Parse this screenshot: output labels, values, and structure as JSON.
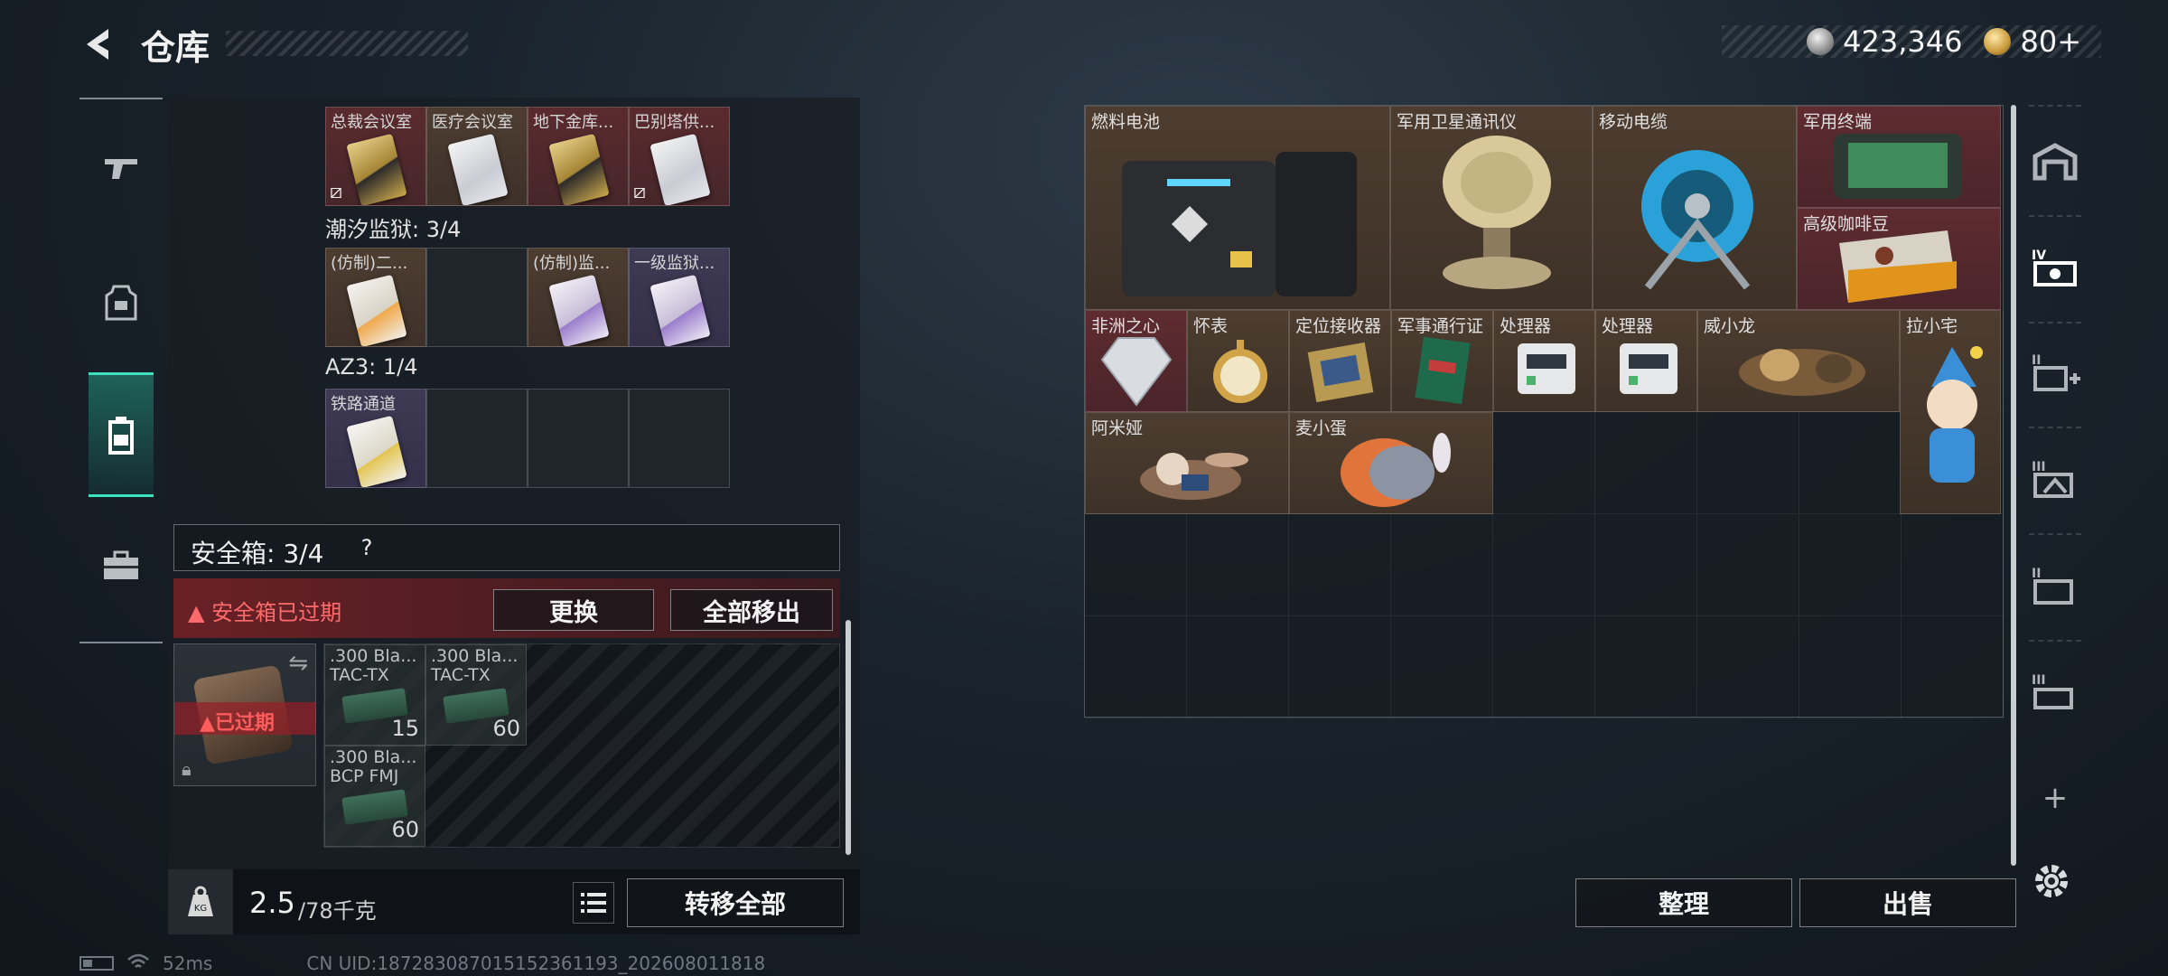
{
  "header": {
    "title": "仓库",
    "silver_value": "423,346",
    "gold_value": "80+"
  },
  "left_nav": {
    "items": [
      "gun-icon",
      "armor-icon",
      "backpack-icon",
      "case-icon"
    ],
    "active": "backpack-icon"
  },
  "keycards": {
    "sections": [
      {
        "label": "",
        "slots": [
          {
            "name": "总裁会议室",
            "card": "gold",
            "bg": "red",
            "locked": true
          },
          {
            "name": "医疗会议室",
            "card": "white",
            "bg": "brown",
            "locked": false
          },
          {
            "name": "地下金库...",
            "card": "gold",
            "bg": "red",
            "locked": false
          },
          {
            "name": "巴别塔供...",
            "card": "white",
            "bg": "red",
            "locked": true
          }
        ]
      },
      {
        "label": "潮汐监狱: 3/4",
        "slots": [
          {
            "name": "(仿制)二...",
            "card": "orange",
            "bg": "brown",
            "locked": false
          },
          {
            "name": "",
            "card": "",
            "bg": "empty",
            "locked": false
          },
          {
            "name": "(仿制)监...",
            "card": "purple",
            "bg": "brown",
            "locked": false
          },
          {
            "name": "一级监狱...",
            "card": "purple",
            "bg": "purple",
            "locked": false
          }
        ]
      },
      {
        "label": "AZ3: 1/4",
        "slots": [
          {
            "name": "铁路通道",
            "card": "gold-white",
            "bg": "purple",
            "locked": false
          },
          {
            "name": "",
            "card": "",
            "bg": "empty",
            "locked": false
          },
          {
            "name": "",
            "card": "",
            "bg": "empty",
            "locked": false
          },
          {
            "name": "",
            "card": "",
            "bg": "empty",
            "locked": false
          }
        ]
      }
    ]
  },
  "safe_box": {
    "title": "安全箱: 3/4",
    "help": "?",
    "expired_warning": "安全箱已过期",
    "replace_label": "更换",
    "move_all_label": "全部移出",
    "tile_expired_label": "已过期",
    "ammo": [
      {
        "line1": ".300 Bla...",
        "line2": "TAC-TX",
        "qty": "15"
      },
      {
        "line1": ".300 Bla...",
        "line2": "TAC-TX",
        "qty": "60"
      },
      {
        "line1": ".300 Bla...",
        "line2": "BCP FMJ",
        "qty": "60"
      }
    ]
  },
  "weight": {
    "current": "2.5",
    "max": "/78千克",
    "transfer_all_label": "转移全部"
  },
  "stash": {
    "items": [
      {
        "name": "燃料电池",
        "bg": "brown"
      },
      {
        "name": "军用卫星通讯仪",
        "bg": "brown"
      },
      {
        "name": "移动电缆",
        "bg": "brown"
      },
      {
        "name": "军用终端",
        "bg": "red"
      },
      {
        "name": "高级咖啡豆",
        "bg": "red"
      },
      {
        "name": "非洲之心",
        "bg": "red"
      },
      {
        "name": "怀表",
        "bg": "brown"
      },
      {
        "name": "定位接收器",
        "bg": "brown"
      },
      {
        "name": "军事通行证",
        "bg": "brown"
      },
      {
        "name": "处理器",
        "bg": "brown"
      },
      {
        "name": "处理器",
        "bg": "brown"
      },
      {
        "name": "威小龙",
        "bg": "brown"
      },
      {
        "name": "拉小宅",
        "bg": "brown"
      },
      {
        "name": "阿米娅",
        "bg": "brown"
      },
      {
        "name": "麦小蛋",
        "bg": "brown"
      }
    ],
    "sort_label": "整理",
    "sell_label": "出售",
    "add_label": "+"
  },
  "status": {
    "ping": "52ms",
    "uid": "CN UID:18728308701515236119​3_202608011818"
  },
  "colors": {
    "accent": "#3fe0bf",
    "warning": "#ff6b6b",
    "brown_slot": "#4d3d30",
    "red_slot": "#5e2b30"
  }
}
